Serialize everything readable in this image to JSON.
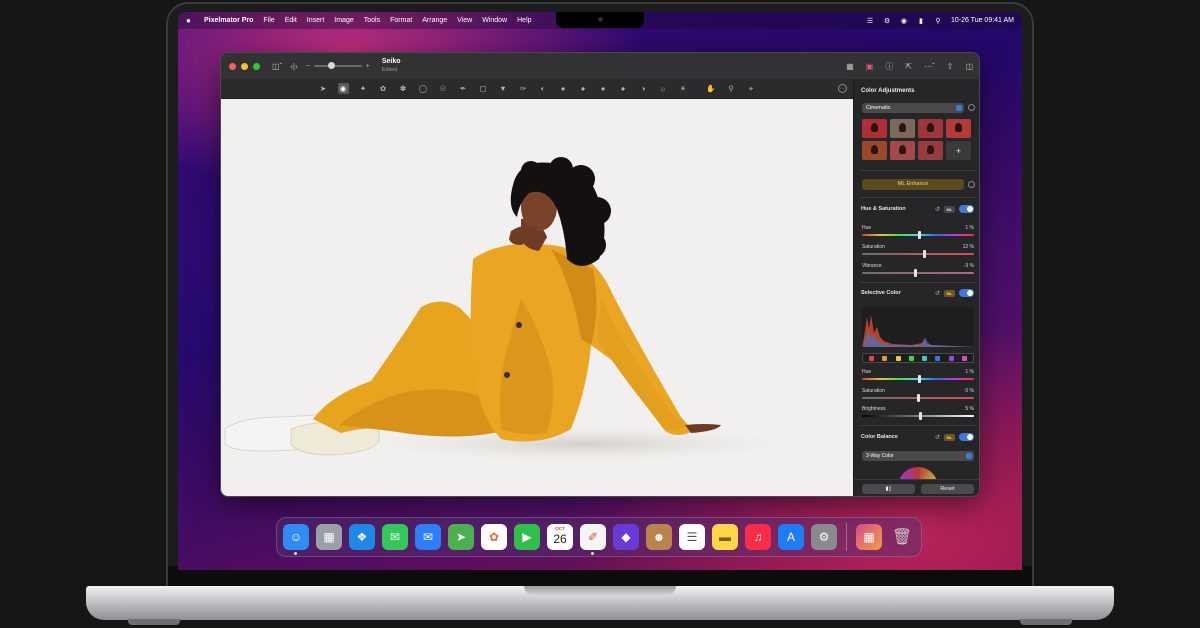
{
  "menubar": {
    "app_name": "Pixelmator Pro",
    "items": [
      "File",
      "Edit",
      "Insert",
      "Image",
      "Tools",
      "Format",
      "Arrange",
      "View",
      "Window",
      "Help"
    ],
    "clock": "10-26 Tue 09:41 AM",
    "status_icons": [
      "layers-icon",
      "control-center-icon",
      "wifi-icon",
      "battery-icon",
      "spotlight-icon"
    ]
  },
  "document": {
    "title": "Seiko",
    "subtitle": "Edited"
  },
  "toolbar": {
    "tools": [
      "arrange-tool",
      "style-tool",
      "select-tool",
      "retouch-tool",
      "paint-tool",
      "erase-tool",
      "smudge-tool",
      "pen-tool",
      "gradient-tool",
      "fill-tool",
      "color-picker-tool",
      "shape-tool",
      "sponge-tool",
      "burn-tool",
      "dodge-tool",
      "sharpen-tool",
      "light-tool",
      "red-eye-tool",
      "pan-tool",
      "zoom-tool",
      "crop-tool"
    ],
    "active_tool": "style-tool"
  },
  "panel": {
    "title": "Color Adjustments",
    "preset": "Cinematic",
    "ml_enhance": "ML Enhance",
    "hue_saturation": {
      "title": "Hue & Saturation",
      "ml": "ML",
      "hue": {
        "label": "Hue",
        "value": "1 %",
        "level": 0.51
      },
      "saturation": {
        "label": "Saturation",
        "value": "12 %",
        "level": 0.56
      },
      "vibrance": {
        "label": "Vibrance",
        "value": "-3 %",
        "level": 0.48
      }
    },
    "selective_color": {
      "title": "Selective Color",
      "ml": "ML",
      "hue": {
        "label": "Hue",
        "value": "1 %",
        "level": 0.51
      },
      "saturation": {
        "label": "Saturation",
        "value": "0 %",
        "level": 0.5
      },
      "brightness": {
        "label": "Brightness",
        "value": "5 %",
        "level": 0.52
      },
      "swatch_colors": [
        "#e24848",
        "#e2963a",
        "#e2d03a",
        "#4ad04a",
        "#3ad0c0",
        "#3a78e2",
        "#9a4ae2",
        "#e24ac0"
      ]
    },
    "color_balance": {
      "title": "Color Balance",
      "ml": "ML",
      "mode": "3-Way Color"
    },
    "reset_label": "Reset"
  },
  "dock": {
    "apps": [
      {
        "name": "finder",
        "color": "#2f8cf5"
      },
      {
        "name": "launchpad",
        "color": "#9aa0a8"
      },
      {
        "name": "safari",
        "color": "#1e88e5"
      },
      {
        "name": "messages",
        "color": "#34c759"
      },
      {
        "name": "mail",
        "color": "#2d7ff9"
      },
      {
        "name": "maps",
        "color": "#4caf50"
      },
      {
        "name": "photos",
        "color": "#ffffff"
      },
      {
        "name": "facetime",
        "color": "#2fbf4a"
      },
      {
        "name": "calendar",
        "color": "#ffffff"
      },
      {
        "name": "pixelmator",
        "color": "#f5f5f5"
      },
      {
        "name": "shortcuts",
        "color": "#6a3ad8"
      },
      {
        "name": "contacts",
        "color": "#b98350"
      },
      {
        "name": "reminders",
        "color": "#ffffff"
      },
      {
        "name": "notes",
        "color": "#ffd64a"
      },
      {
        "name": "music",
        "color": "#fa2d48"
      },
      {
        "name": "app-store",
        "color": "#1f7cf5"
      },
      {
        "name": "system-preferences",
        "color": "#8a8a8e"
      }
    ],
    "calendar_month": "OCT",
    "calendar_day": "26"
  }
}
